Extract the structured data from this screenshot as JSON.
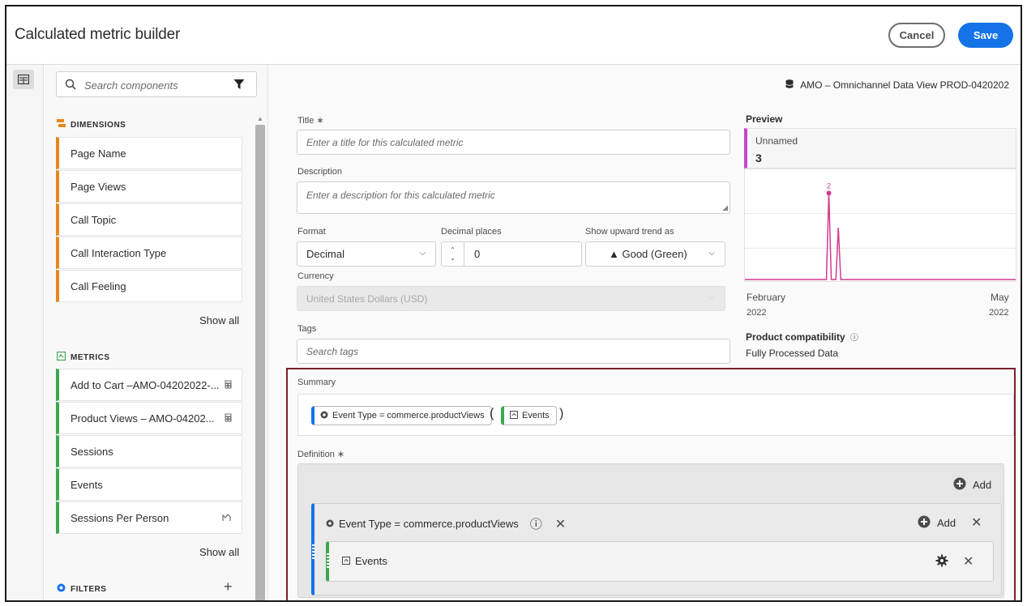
{
  "header": {
    "title": "Calculated metric builder",
    "cancel_label": "Cancel",
    "save_label": "Save"
  },
  "sidebar": {
    "search_placeholder": "Search components",
    "dimensions_title": "DIMENSIONS",
    "dimensions": [
      "Page Name",
      "Page Views",
      "Call Topic",
      "Call Interaction Type",
      "Call Feeling"
    ],
    "show_all_1": "Show all",
    "metrics_title": "METRICS",
    "metrics": [
      {
        "label": "Add to Cart –AMO-04202022-...",
        "icon": "calculator-icon"
      },
      {
        "label": "Product Views – AMO-04202...",
        "icon": "calculator-icon"
      },
      {
        "label": "Sessions",
        "icon": ""
      },
      {
        "label": "Events",
        "icon": ""
      },
      {
        "label": "Sessions Per Person",
        "icon": "trend-icon"
      }
    ],
    "show_all_2": "Show all",
    "filters_title": "FILTERS"
  },
  "main": {
    "data_view": "AMO – Omnichannel Data View PROD-0420202",
    "title_label": "Title ∗",
    "title_placeholder": "Enter a title for this calculated metric",
    "description_label": "Description",
    "description_placeholder": "Enter a description for this calculated metric",
    "format_label": "Format",
    "format_value": "Decimal",
    "decimal_label": "Decimal places",
    "decimal_value": "0",
    "trend_label": "Show upward trend as",
    "trend_value": "▲ Good (Green)",
    "currency_label": "Currency",
    "currency_value": "United States Dollars (USD)",
    "tags_label": "Tags",
    "tags_placeholder": "Search tags"
  },
  "preview": {
    "title": "Preview",
    "metric_name": "Unnamed",
    "metric_value": "3",
    "x_start_month": "February",
    "x_start_year": "2022",
    "x_end_month": "May",
    "x_end_year": "2022",
    "compat_title": "Product compatibility",
    "compat_value": "Fully Processed Data"
  },
  "chart_data": {
    "type": "line",
    "x": [
      "February 2022",
      "",
      "",
      "",
      "",
      "",
      "",
      "",
      "",
      "",
      "",
      "",
      "May 2022"
    ],
    "series": [
      {
        "values": [
          0,
          0,
          0,
          0,
          0,
          0,
          0,
          0,
          0,
          0,
          0,
          0,
          0
        ],
        "color": "#d23c8f"
      }
    ],
    "spikes": [
      {
        "position": 0.31,
        "value": 2,
        "label": "2"
      },
      {
        "position": 0.345,
        "value": 1.2
      }
    ],
    "ylim": [
      0,
      2.4
    ],
    "grid": true
  },
  "summary": {
    "label": "Summary",
    "filter_pill": "Event Type = commerce.productViews",
    "metric_pill": "Events",
    "open_paren": "(",
    "close_paren": ")"
  },
  "definition": {
    "label": "Definition ∗",
    "add_label": "Add",
    "container_filter": "Event Type = commerce.productViews",
    "container_add": "Add",
    "metric": "Events"
  },
  "colors": {
    "accent": "#1473e6",
    "dimension": "#e68619",
    "metric": "#3da74e",
    "preview": "#c945c9",
    "highlight": "#7a1f2b"
  }
}
